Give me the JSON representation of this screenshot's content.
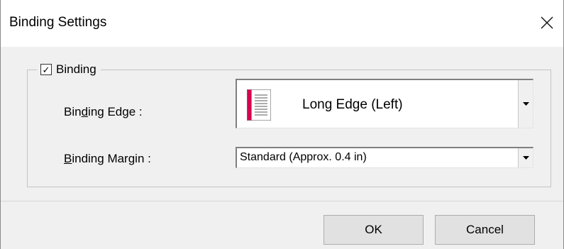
{
  "window": {
    "title": "Binding Settings",
    "close_icon": "close-icon"
  },
  "binding_group": {
    "checkbox_checked": true,
    "checkbox_mark": "✓",
    "label_prefix": "Binding",
    "label_underlined": ""
  },
  "binding_edge": {
    "label_pre": "Bin",
    "label_accel": "d",
    "label_post": "ing Edge :",
    "selected_value": "Long Edge (Left)",
    "icon": "book-left-binding-icon"
  },
  "binding_margin": {
    "label_accel": "B",
    "label_post": "inding Margin :",
    "selected_value": "Standard (Approx. 0.4 in)"
  },
  "buttons": {
    "ok_label": "OK",
    "cancel_label": "Cancel"
  },
  "colors": {
    "book_spine": "#d6004f",
    "dialog_bg": "#f0f0f0"
  }
}
